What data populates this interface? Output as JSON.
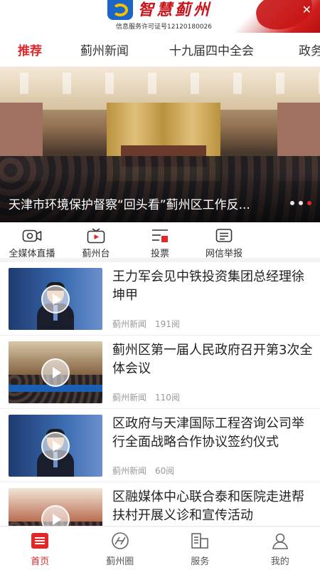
{
  "header": {
    "brand": "智慧蓟州",
    "license": "信息服务许可证号12120180026"
  },
  "tabs": [
    {
      "label": "推荐",
      "active": true
    },
    {
      "label": "蓟州新闻",
      "active": false
    },
    {
      "label": "十九届四中全会",
      "active": false
    },
    {
      "label": "政务",
      "active": false
    }
  ],
  "banner": {
    "caption": "天津市环境保护督察“回头看”蓟州区工作反...",
    "dots": 3,
    "active_dot": 2
  },
  "quicknav": [
    {
      "label": "全媒体直播",
      "icon": "video-camera-icon"
    },
    {
      "label": "蓟州台",
      "icon": "tv-icon"
    },
    {
      "label": "投票",
      "icon": "vote-icon"
    },
    {
      "label": "网信举报",
      "icon": "report-icon"
    }
  ],
  "news": [
    {
      "title": "王力军会见中铁投资集团总经理徐坤甲",
      "source": "蓟州新闻",
      "views": "191阅"
    },
    {
      "title": "蓟州区第一届人民政府召开第3次全体会议",
      "source": "蓟州新闻",
      "views": "110阅"
    },
    {
      "title": "区政府与天津国际工程咨询公司举行全面战略合作协议签约仪式",
      "source": "蓟州新闻",
      "views": "60阅"
    },
    {
      "title": "区融媒体中心联合泰和医院走进帮扶村开展义诊和宣传活动",
      "source": "",
      "views": ""
    }
  ],
  "bottomnav": [
    {
      "label": "首页",
      "icon": "home-icon",
      "active": true
    },
    {
      "label": "蓟州圈",
      "icon": "circle-icon",
      "active": false
    },
    {
      "label": "服务",
      "icon": "service-icon",
      "active": false
    },
    {
      "label": "我的",
      "icon": "profile-icon",
      "active": false
    }
  ],
  "colors": {
    "accent": "#e02828",
    "brand_blue": "#1b64c8"
  }
}
